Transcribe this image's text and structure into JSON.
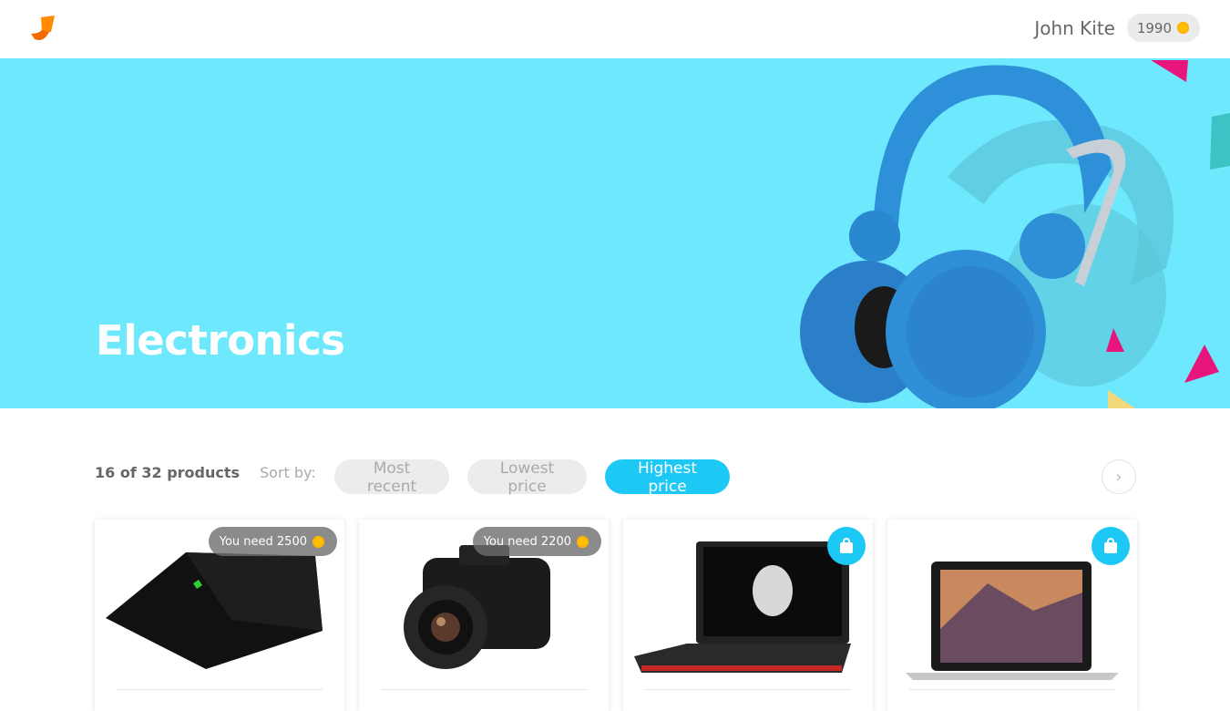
{
  "header": {
    "logo_icon": "bird-logo-icon",
    "user_name": "John Kite",
    "points": "1990",
    "coin_icon": "coin-icon"
  },
  "hero": {
    "title": "Electronics",
    "background_color": "#6de8fd",
    "image": "blue-headphones-image"
  },
  "toolbar": {
    "count": "16 of 32 products",
    "sort_label": "Sort by:",
    "sort_options": [
      "Most recent",
      "Lowest price",
      "Highest price"
    ],
    "active_sort": "Highest price",
    "next_icon": "chevron-right-icon",
    "accent_color": "#1dc8f4"
  },
  "products": [
    {
      "image": "black-laptop-image",
      "action": "need",
      "need_label": "You need 2500"
    },
    {
      "image": "dslr-camera-image",
      "action": "need",
      "need_label": "You need 2200"
    },
    {
      "image": "gaming-laptop-image",
      "action": "buy",
      "icon": "shopping-bag-icon"
    },
    {
      "image": "macbook-image",
      "action": "buy",
      "icon": "shopping-bag-icon"
    }
  ]
}
